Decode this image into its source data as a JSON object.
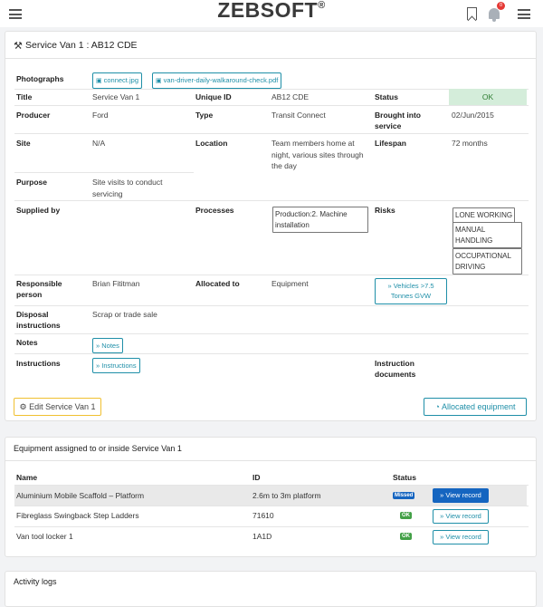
{
  "header": {
    "brand": "ZEBSOFT",
    "brand_mark": "®",
    "notification_count": "0"
  },
  "record": {
    "title": "Service Van 1 : AB12 CDE",
    "photographs_label": "Photographs",
    "photos": [
      "connect.jpg",
      "van-driver-daily-walkaround-check.pdf"
    ],
    "fields": {
      "title_label": "Title",
      "title_value": "Service Van 1",
      "unique_id_label": "Unique ID",
      "unique_id_value": "AB12 CDE",
      "status_label": "Status",
      "status_value": "OK",
      "producer_label": "Producer",
      "producer_value": "Ford",
      "type_label": "Type",
      "type_value": "Transit Connect",
      "brought_label": "Brought into service",
      "brought_value": "02/Jun/2015",
      "site_label": "Site",
      "site_value": "N/A",
      "location_label": "Location",
      "location_value": "Team members home at night, various sites through the day",
      "lifespan_label": "Lifespan",
      "lifespan_value": "72 months",
      "purpose_label": "Purpose",
      "purpose_value": "Site visits to conduct servicing",
      "supplied_label": "Supplied by",
      "processes_label": "Processes",
      "processes_value": "Production:2. Machine installation",
      "risks_label": "Risks",
      "risks": [
        "LONE WORKING",
        "MANUAL HANDLING",
        "OCCUPATIONAL DRIVING"
      ],
      "responsible_label": "Responsible person",
      "responsible_value": "Brian Fititman",
      "allocated_label": "Allocated to",
      "allocated_value": "Equipment",
      "allocated_link": "» Vehicles >7.5 Tonnes GVW",
      "disposal_label": "Disposal instructions",
      "disposal_value": "Scrap or trade sale",
      "notes_label": "Notes",
      "notes_link": "» Notes",
      "instructions_label": "Instructions",
      "instructions_link": "» Instructions",
      "instruction_docs_label": "Instruction documents"
    },
    "edit_button": "Edit Service Van 1",
    "allocated_equipment_button": "Allocated equipment"
  },
  "equipment": {
    "title": "Equipment assigned to or inside Service Van 1",
    "columns": [
      "Name",
      "ID",
      "Status"
    ],
    "rows": [
      {
        "name": "Aluminium Mobile Scaffold – Platform",
        "id": "2.6m to 3m platform",
        "status": "Missed",
        "action": "» View record"
      },
      {
        "name": "Fibreglass Swingback Step Ladders",
        "id": "71610",
        "status": "OK",
        "action": "» View record"
      },
      {
        "name": "Van tool locker 1",
        "id": "1A1D",
        "status": "OK",
        "action": "» View record"
      }
    ]
  },
  "activity": {
    "title": "Activity logs"
  }
}
